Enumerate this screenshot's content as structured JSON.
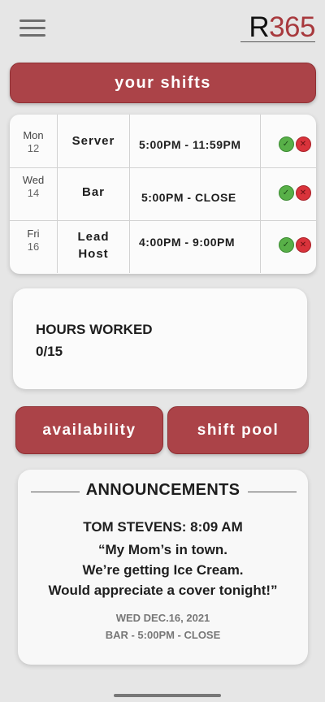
{
  "app": {
    "logo_r": "R",
    "logo_num": "365"
  },
  "header": {
    "menu_icon": "hamburger-menu-icon"
  },
  "your_shifts_label": "your shifts",
  "shifts": [
    {
      "day": "Mon",
      "date": "12",
      "role_lines": [
        "Server"
      ],
      "time": "5:00PM - 11:59PM"
    },
    {
      "day": "Wed",
      "date": "14",
      "role_lines": [
        "Bar"
      ],
      "time": "5:00PM - CLOSE"
    },
    {
      "day": "Fri",
      "date": "16",
      "role_lines": [
        "Lead",
        "Host"
      ],
      "time": "4:00PM - 9:00PM"
    }
  ],
  "hours": {
    "label": "HOURS WORKED",
    "value": "0/15"
  },
  "buttons": {
    "availability": "availability",
    "shift_pool": "shift pool"
  },
  "announcements": {
    "title": "ANNOUNCEMENTS",
    "author_line": "TOM STEVENS: 8:09 AM",
    "message_lines": [
      "“My Mom’s in town.",
      "We’re getting Ice Cream.",
      "Would appreciate a cover tonight!”"
    ],
    "date": "WED DEC.16, 2021",
    "detail": "BAR - 5:00PM - CLOSE"
  },
  "colors": {
    "accent": "#ab4348",
    "accept": "#58b048",
    "decline": "#d9333b",
    "background": "#e6e6e6"
  }
}
